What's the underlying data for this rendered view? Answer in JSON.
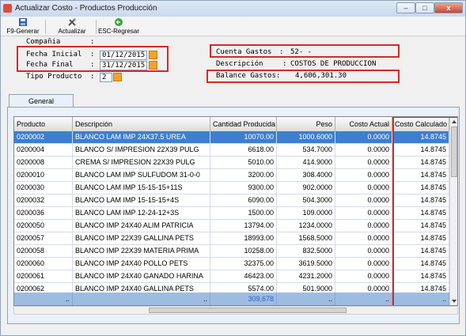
{
  "window": {
    "title": "Actualizar Costo - Productos Producción"
  },
  "toolbar": {
    "generar": "F9-Generar",
    "actualizar": "Actualizar",
    "regresar": "ESC-Regresar"
  },
  "form": {
    "compania_label": "Compañia",
    "compania_value": "",
    "fecha_inicial_label": "Fecha Inicial",
    "fecha_inicial_value": "01/12/2015",
    "fecha_final_label": "Fecha Final",
    "fecha_final_value": "31/12/2015",
    "tipo_producto_label": "Tipo Producto",
    "tipo_producto_value": "2",
    "cuenta_gastos_label": "Cuenta Gastos",
    "cuenta_gastos_value": "52-  -",
    "descripcion_label": "Descripción",
    "descripcion_value": "COSTOS DE PRODUCCION",
    "balance_gastos_label": "Balance Gastos:",
    "balance_gastos_value": "4,606,301.30"
  },
  "tabs": [
    "General"
  ],
  "grid": {
    "columns": [
      "Producto",
      "Descripción",
      "Cantidad Producida",
      "Peso",
      "Costo Actual",
      "Costo Calculado"
    ],
    "rows": [
      [
        "0200002",
        "BLANCO LAM IMP 24X37.5 UREA",
        "10070.00",
        "1000.6000",
        "0.0000",
        "14.8745"
      ],
      [
        "0200004",
        "BLANCO S/ IMPRESION 22X39 PULG",
        "6618.00",
        "534.7000",
        "0.0000",
        "14.8745"
      ],
      [
        "0200008",
        "CREMA S/ IMPRESION 22X39 PULG",
        "5010.00",
        "414.9000",
        "0.0000",
        "14.8745"
      ],
      [
        "0200010",
        "BLANCO LAM IMP SULFUDOM 31-0-0",
        "3200.00",
        "308.4000",
        "0.0000",
        "14.8745"
      ],
      [
        "0200030",
        "BLANCO LAM IMP 15-15-15+11S",
        "9300.00",
        "902.0000",
        "0.0000",
        "14.8745"
      ],
      [
        "0200032",
        "BLANCO LAM IMP 15-15-15+4S",
        "6090.00",
        "504.3000",
        "0.0000",
        "14.8745"
      ],
      [
        "0200036",
        "BLANCO LAM IMP 12-24-12+3S",
        "1500.00",
        "109.0000",
        "0.0000",
        "14.8745"
      ],
      [
        "0200050",
        "BLANCO IMP 24X40 ALIM PATRICIA",
        "13794.00",
        "1234.0000",
        "0.0000",
        "14.8745"
      ],
      [
        "0200057",
        "BLANCO IMP 22X39 GALLINA PETS",
        "18993.00",
        "1568.5000",
        "0.0000",
        "14.8745"
      ],
      [
        "0200058",
        "BLANCO IMP 22X39 MATERIA PRIMA",
        "10258.00",
        "832.5000",
        "0.0000",
        "14.8745"
      ],
      [
        "0200060",
        "BLANCO IMP 24X40 POLLO PETS",
        "32375.00",
        "3619.5000",
        "0.0000",
        "14.8745"
      ],
      [
        "0200061",
        "BLANCO IMP 24X40 GANADO HARINA",
        "46423.00",
        "4231.2000",
        "0.0000",
        "14.8745"
      ],
      [
        "0200062",
        "BLANCO IMP 24X40 GALLINA PETS",
        "5574.00",
        "501.9000",
        "0.0000",
        "14.8745"
      ]
    ],
    "selected_row": 0,
    "totals": [
      "..",
      "..",
      "309,678",
      "..",
      "..",
      ".."
    ]
  }
}
